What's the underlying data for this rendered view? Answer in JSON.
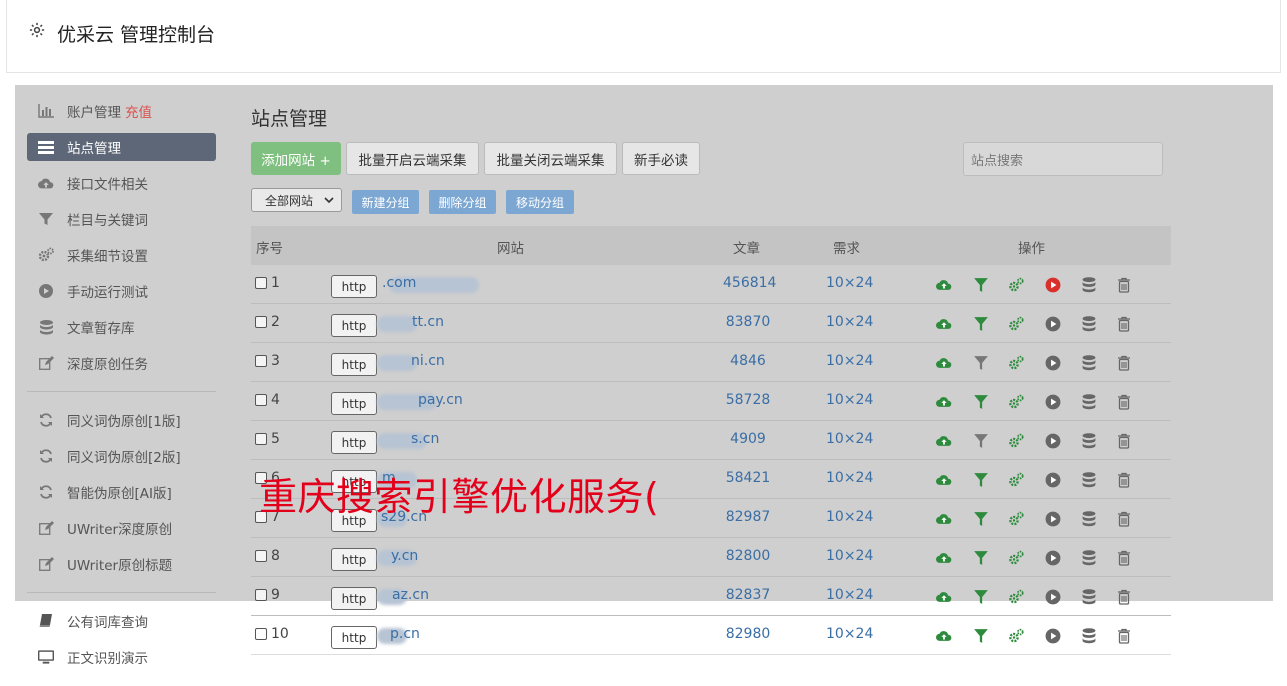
{
  "header": {
    "title": "优采云 管理控制台",
    "icon": "gear-icon"
  },
  "sidebar": {
    "items": [
      {
        "label": "账户管理",
        "badge": "充值",
        "icon": "bar-chart-icon"
      },
      {
        "label": "站点管理",
        "icon": "list-icon",
        "active": true
      },
      {
        "label": "接口文件相关",
        "icon": "cloud-upload-icon"
      },
      {
        "label": "栏目与关键词",
        "icon": "filter-icon"
      },
      {
        "label": "采集细节设置",
        "icon": "gears-icon"
      },
      {
        "label": "手动运行测试",
        "icon": "play-icon"
      },
      {
        "label": "文章暂存库",
        "icon": "database-icon"
      },
      {
        "label": "深度原创任务",
        "icon": "edit-icon"
      },
      {
        "label": "同义词伪原创[1版]",
        "icon": "refresh-icon"
      },
      {
        "label": "同义词伪原创[2版]",
        "icon": "refresh-icon"
      },
      {
        "label": "智能伪原创[AI版]",
        "icon": "refresh-icon"
      },
      {
        "label": "UWriter深度原创",
        "icon": "edit-icon"
      },
      {
        "label": "UWriter原创标题",
        "icon": "edit-icon"
      },
      {
        "label": "公有词库查询",
        "icon": "book-icon"
      },
      {
        "label": "正文识别演示",
        "icon": "monitor-icon"
      }
    ]
  },
  "page": {
    "title": "站点管理",
    "toolbar": {
      "add": "添加网站 +",
      "batch_open": "批量开启云端采集",
      "batch_close": "批量关闭云端采集",
      "guide": "新手必读"
    },
    "search_placeholder": "站点搜索",
    "group_select": "全部网站",
    "group_buttons": {
      "new": "新建分组",
      "delete": "删除分组",
      "move": "移动分组"
    }
  },
  "table": {
    "headers": {
      "index": "序号",
      "site": "网站",
      "articles": "文章",
      "demand": "需求",
      "ops": "操作"
    },
    "protocol_label": "http",
    "rows": [
      {
        "index": "1",
        "site": "v.com",
        "site_text": ".com",
        "articles": "456814",
        "demand": "10×24",
        "running": true
      },
      {
        "index": "2",
        "site_text": "tt.cn",
        "articles": "83870",
        "demand": "10×24",
        "running": false
      },
      {
        "index": "3",
        "site_text": "ni.cn",
        "articles": "4846",
        "demand": "10×24",
        "running": false
      },
      {
        "index": "4",
        "site_text": "pay.cn",
        "articles": "58728",
        "demand": "10×24",
        "running": false
      },
      {
        "index": "5",
        "site_text": "s.cn",
        "articles": "4909",
        "demand": "10×24",
        "running": false
      },
      {
        "index": "6",
        "site_text": "m",
        "articles": "58421",
        "demand": "10×24",
        "running": false
      },
      {
        "index": "7",
        "site_text": "s29.cn",
        "articles": "82987",
        "demand": "10×24",
        "running": false
      },
      {
        "index": "8",
        "site_text": "y.cn",
        "articles": "82800",
        "demand": "10×24",
        "running": false
      },
      {
        "index": "9",
        "site_text": "az.cn",
        "articles": "82837",
        "demand": "10×24",
        "running": false
      },
      {
        "index": "10",
        "site_text": "p.cn",
        "articles": "82980",
        "demand": "10×24",
        "running": false
      }
    ]
  },
  "overlay": {
    "text": "重庆搜索引擎优化服务("
  },
  "colors": {
    "accent_green": "#2e8b3e",
    "link_blue": "#3a6ea5",
    "danger": "#d9534f",
    "sidebar_active": "#5e6777"
  }
}
